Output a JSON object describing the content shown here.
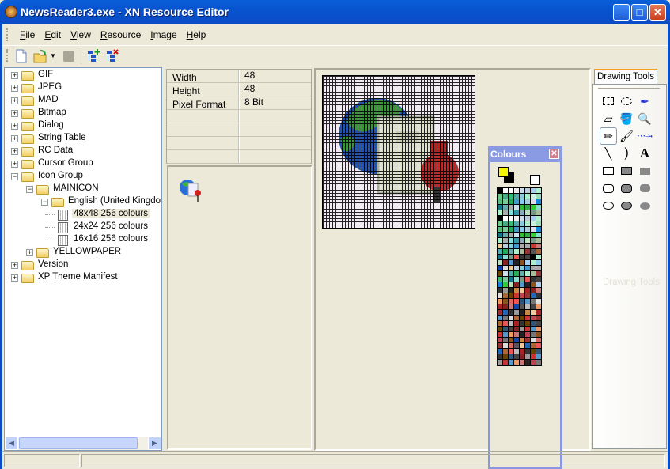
{
  "window": {
    "title": "NewsReader3.exe - XN Resource Editor",
    "minimize": "_",
    "maximize": "□",
    "close": "✕"
  },
  "menu": [
    {
      "label": "File",
      "key": "F",
      "rest": "ile"
    },
    {
      "label": "Edit",
      "key": "E",
      "rest": "dit"
    },
    {
      "label": "View",
      "key": "V",
      "rest": "iew"
    },
    {
      "label": "Resource",
      "key": "R",
      "rest": "esource"
    },
    {
      "label": "Image",
      "key": "I",
      "rest": "mage"
    },
    {
      "label": "Help",
      "key": "H",
      "rest": "elp"
    }
  ],
  "toolbar": [
    "new-file-icon",
    "open-folder-icon",
    "save-icon",
    "add-resource-icon",
    "delete-resource-icon"
  ],
  "tree": {
    "nodes": [
      {
        "label": "GIF",
        "level": 0,
        "type": "folder",
        "toggle": "+"
      },
      {
        "label": "JPEG",
        "level": 0,
        "type": "folder",
        "toggle": "+"
      },
      {
        "label": "MAD",
        "level": 0,
        "type": "folder",
        "toggle": "+"
      },
      {
        "label": "Bitmap",
        "level": 0,
        "type": "folder",
        "toggle": "+"
      },
      {
        "label": "Dialog",
        "level": 0,
        "type": "folder",
        "toggle": "+"
      },
      {
        "label": "String Table",
        "level": 0,
        "type": "folder",
        "toggle": "+"
      },
      {
        "label": "RC Data",
        "level": 0,
        "type": "folder",
        "toggle": "+"
      },
      {
        "label": "Cursor Group",
        "level": 0,
        "type": "folder",
        "toggle": "+"
      },
      {
        "label": "Icon Group",
        "level": 0,
        "type": "folder",
        "toggle": "-"
      },
      {
        "label": "MAINICON",
        "level": 1,
        "type": "folder",
        "toggle": "-"
      },
      {
        "label": "English (United Kingdom",
        "level": 2,
        "type": "folder",
        "toggle": "-"
      },
      {
        "label": "48x48 256 colours",
        "level": 3,
        "type": "file",
        "selected": true
      },
      {
        "label": "24x24 256 colours",
        "level": 3,
        "type": "file"
      },
      {
        "label": "16x16 256 colours",
        "level": 3,
        "type": "file"
      },
      {
        "label": "YELLOWPAPER",
        "level": 1,
        "type": "folder",
        "toggle": "+"
      },
      {
        "label": "Version",
        "level": 0,
        "type": "folder",
        "toggle": "+"
      },
      {
        "label": "XP Theme Manifest",
        "level": 0,
        "type": "folder",
        "toggle": "+"
      }
    ]
  },
  "properties": [
    {
      "key": "Width",
      "value": "48"
    },
    {
      "key": "Height",
      "value": "48"
    },
    {
      "key": "Pixel Format",
      "value": "8 Bit"
    },
    {
      "key": "",
      "value": ""
    },
    {
      "key": "",
      "value": ""
    },
    {
      "key": "",
      "value": ""
    },
    {
      "key": "",
      "value": ""
    }
  ],
  "drawing_tools": {
    "tab": "Drawing Tools",
    "ghost_label": "Drawing Tools",
    "tools": [
      "rect-select-icon",
      "lasso-select-icon",
      "eyedropper-icon",
      "eraser-icon",
      "fill-bucket-icon",
      "magnifier-icon",
      "pencil-icon",
      "brush-icon",
      "airbrush-icon",
      "line-icon",
      "curve-icon",
      "text-icon",
      "rectangle-outline-icon",
      "rectangle-filled-outline-icon",
      "rectangle-filled-icon",
      "rounded-rect-outline-icon",
      "rounded-rect-filled-outline-icon",
      "rounded-rect-filled-icon",
      "ellipse-outline-icon",
      "ellipse-filled-outline-icon",
      "ellipse-filled-icon"
    ],
    "active": "pencil-icon"
  },
  "colours": {
    "title": "Colours",
    "foreground": "#f5f500",
    "background": "#000000"
  }
}
